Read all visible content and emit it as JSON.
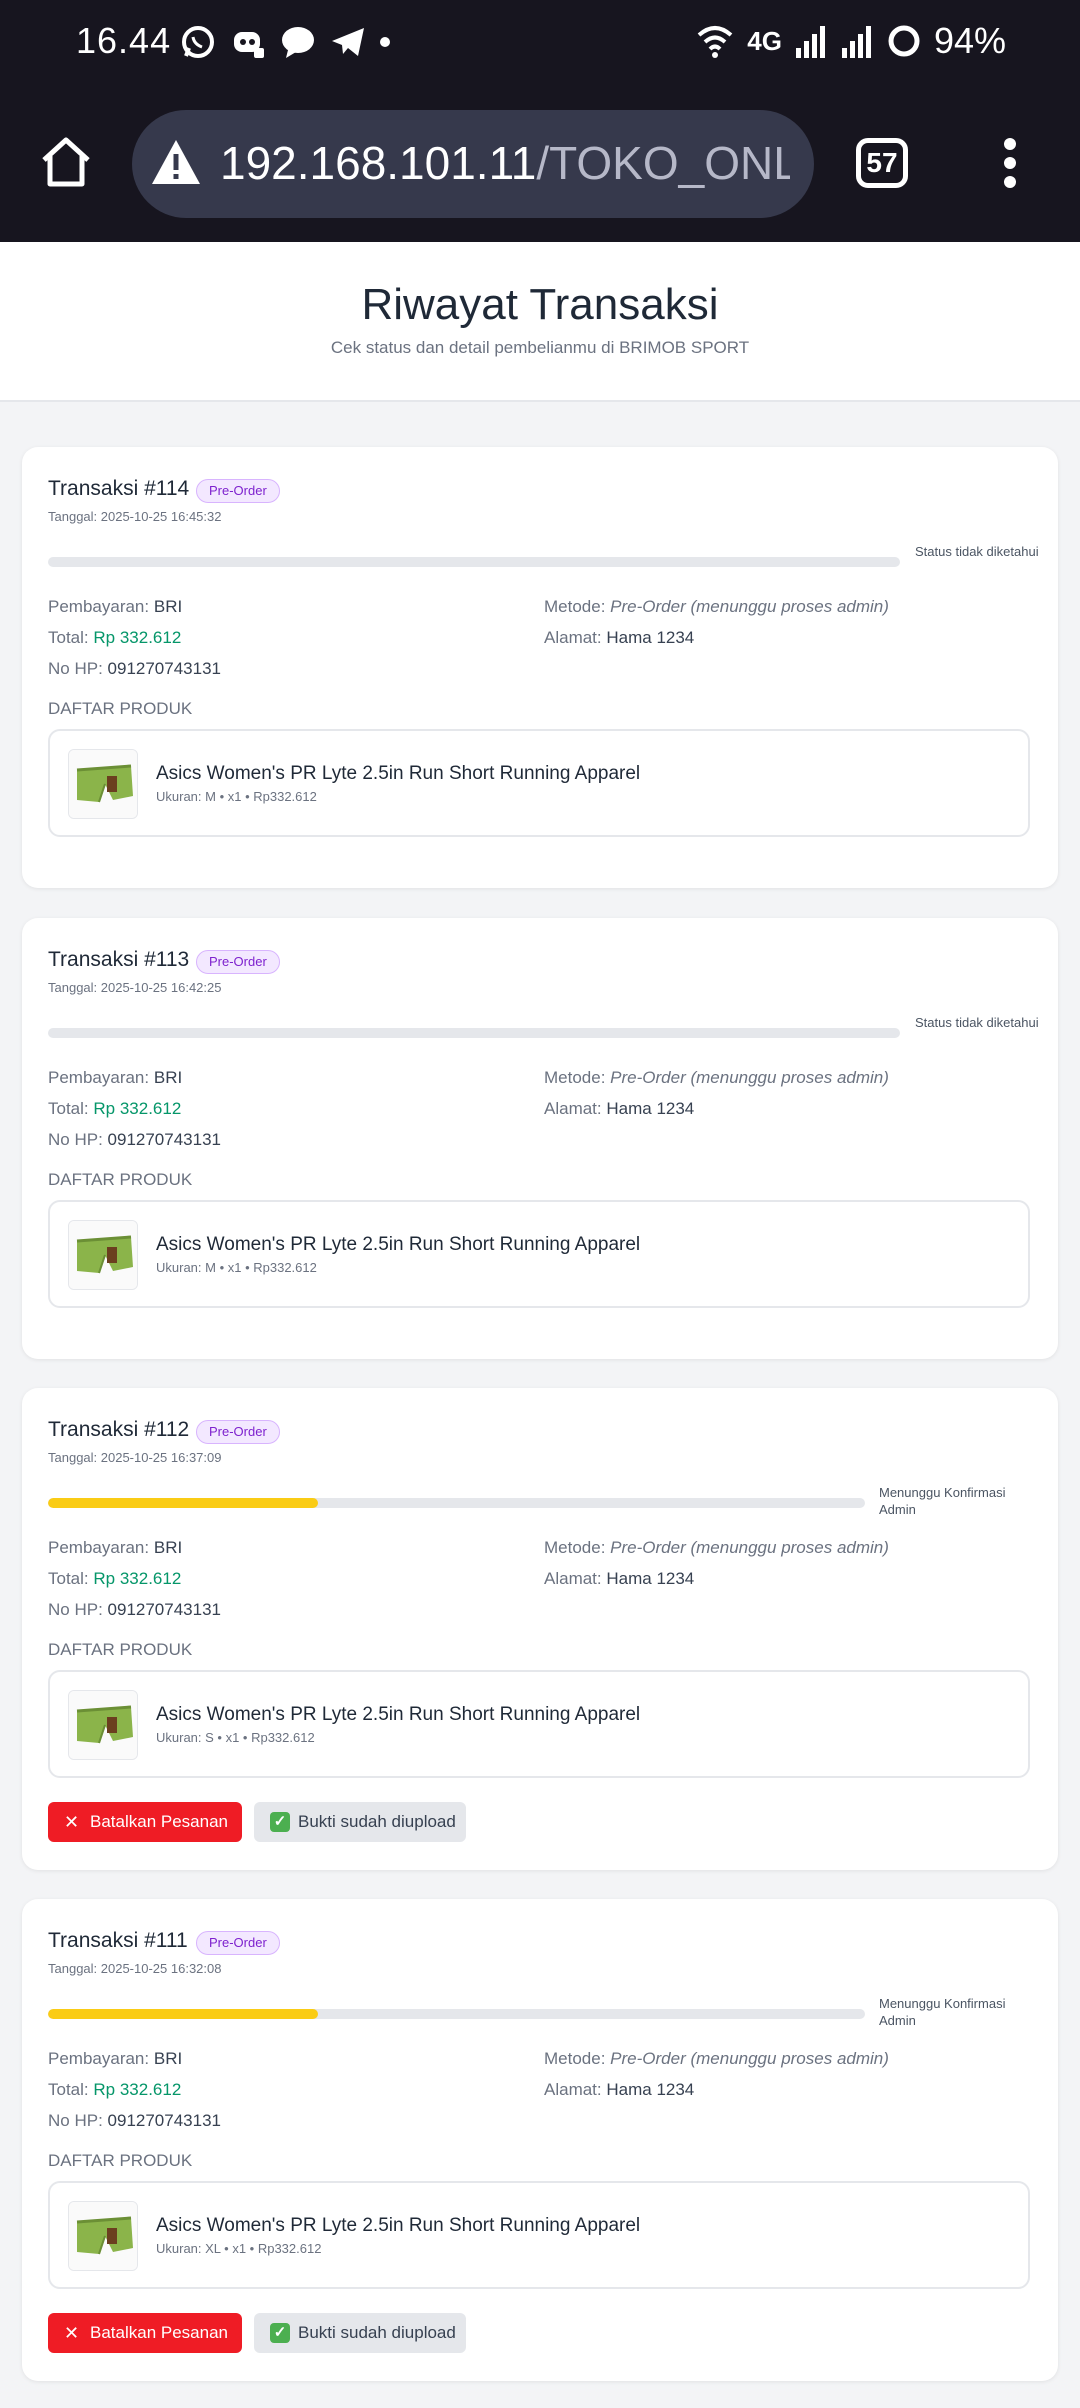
{
  "status_bar": {
    "time": "16.44",
    "network": "4G",
    "battery": "94%",
    "app_icons": [
      "whatsapp-icon",
      "discord-icon",
      "messages-icon",
      "telegram-icon",
      "more-dot-icon"
    ]
  },
  "browser": {
    "url_host": "192.168.101.11",
    "url_path": "/TOKO_ONLINE/t",
    "tab_count": "57"
  },
  "page": {
    "title": "Riwayat Transaksi",
    "subtitle": "Cek status dan detail pembelianmu di BRIMOB SPORT"
  },
  "labels": {
    "payment": "Pembayaran:",
    "total": "Total:",
    "phone": "No HP:",
    "method": "Metode:",
    "address": "Alamat:",
    "products": "DAFTAR PRODUK",
    "cancel": "Batalkan Pesanan",
    "proof": "Bukti sudah diupload"
  },
  "transactions": [
    {
      "title": "Transaksi #114",
      "badge": "Pre-Order",
      "date": "Tanggal: 2025-10-25 16:45:32",
      "progress": 0,
      "status": "Status tidak diketahui",
      "payment": "BRI",
      "total": "Rp 332.612",
      "phone": "091270743131",
      "method": "Pre-Order (menunggu proses admin)",
      "address": "Hama 1234",
      "product_name": "Asics Women's PR Lyte 2.5in Run Short Running Apparel",
      "product_meta": "Ukuran: M • x1 • Rp332.612",
      "actions": false
    },
    {
      "title": "Transaksi #113",
      "badge": "Pre-Order",
      "date": "Tanggal: 2025-10-25 16:42:25",
      "progress": 0,
      "status": "Status tidak diketahui",
      "payment": "BRI",
      "total": "Rp 332.612",
      "phone": "091270743131",
      "method": "Pre-Order (menunggu proses admin)",
      "address": "Hama 1234",
      "product_name": "Asics Women's PR Lyte 2.5in Run Short Running Apparel",
      "product_meta": "Ukuran: M • x1 • Rp332.612",
      "actions": false
    },
    {
      "title": "Transaksi #112",
      "badge": "Pre-Order",
      "date": "Tanggal: 2025-10-25 16:37:09",
      "progress": 0.33,
      "status": "Menunggu Konfirmasi Admin",
      "payment": "BRI",
      "total": "Rp 332.612",
      "phone": "091270743131",
      "method": "Pre-Order (menunggu proses admin)",
      "address": "Hama 1234",
      "product_name": "Asics Women's PR Lyte 2.5in Run Short Running Apparel",
      "product_meta": "Ukuran: S • x1 • Rp332.612",
      "actions": true
    },
    {
      "title": "Transaksi #111",
      "badge": "Pre-Order",
      "date": "Tanggal: 2025-10-25 16:32:08",
      "progress": 0.33,
      "status": "Menunggu Konfirmasi Admin",
      "payment": "BRI",
      "total": "Rp 332.612",
      "phone": "091270743131",
      "method": "Pre-Order (menunggu proses admin)",
      "address": "Hama 1234",
      "product_name": "Asics Women's PR Lyte 2.5in Run Short Running Apparel",
      "product_meta": "Ukuran: XL • x1 • Rp332.612",
      "actions": true
    }
  ],
  "colors": {
    "accent_green": "#059669",
    "progress_yellow": "#facc15",
    "cancel_red": "#ef1c25",
    "badge_purple": "#7e22ce"
  }
}
